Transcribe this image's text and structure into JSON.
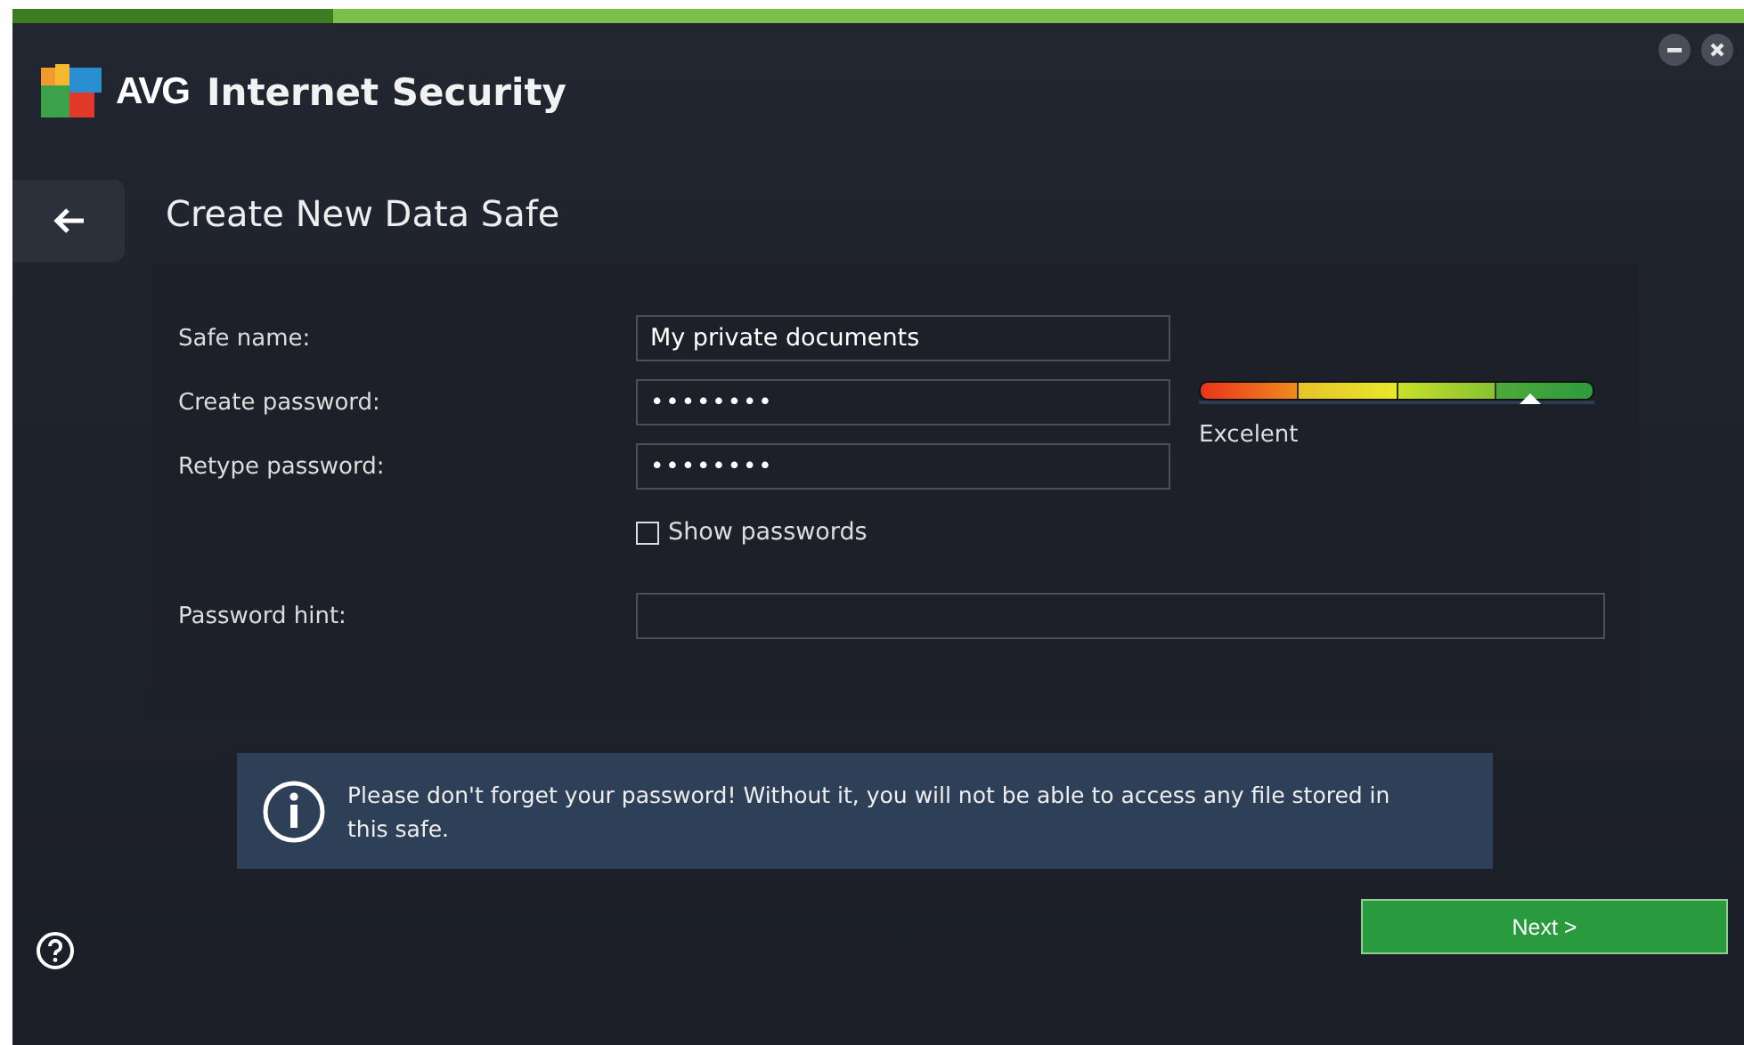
{
  "window": {
    "brand": "AVG",
    "title": "Internet Security"
  },
  "page_title": "Create New Data Safe",
  "fields": [
    {
      "kind": "text",
      "label": "Safe name:",
      "value": "My private documents"
    },
    {
      "kind": "password",
      "label": "Create password:",
      "value": "••••••••"
    },
    {
      "kind": "password",
      "label": "Retype password:",
      "value": "••••••••"
    },
    {
      "kind": "checkbox",
      "label": "Show passwords",
      "checked": false
    },
    {
      "kind": "hint",
      "label": "Password hint:"
    }
  ],
  "strength": {
    "level": 0.84,
    "label": "Excelent"
  },
  "info": "Please don't forget your password! Without it, you will not be able to access any file stored in this safe.",
  "next_button": "Next >"
}
